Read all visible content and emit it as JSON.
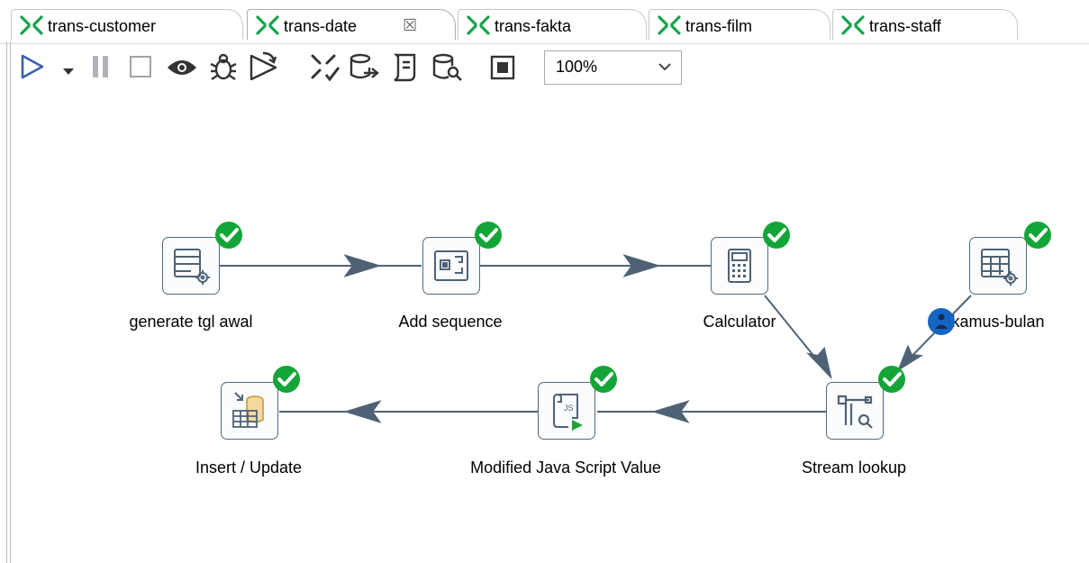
{
  "tabs": [
    {
      "label": "trans-customer",
      "active": false
    },
    {
      "label": "trans-date",
      "active": true,
      "close_glyph": "☒"
    },
    {
      "label": "trans-fakta",
      "active": false
    },
    {
      "label": "trans-film",
      "active": false
    },
    {
      "label": "trans-staff",
      "active": false
    }
  ],
  "toolbar": {
    "buttons": [
      "run-icon",
      "run-options-dropdown-icon",
      "pause-icon",
      "stop-icon",
      "preview-icon",
      "debug-icon",
      "replay-icon",
      "verify-icon",
      "impact-icon",
      "sql-icon",
      "explore-db-icon",
      "show-results-icon"
    ],
    "zoom": {
      "value": "100%"
    }
  },
  "steps": {
    "generate": {
      "label": "generate tgl awal"
    },
    "sequence": {
      "label": "Add sequence"
    },
    "calculator": {
      "label": "Calculator"
    },
    "kamus": {
      "label": "kamus-bulan"
    },
    "stream": {
      "label": "Stream lookup"
    },
    "script": {
      "label": "Modified Java Script Value"
    },
    "insert": {
      "label": "Insert / Update"
    }
  },
  "colors": {
    "check": "#13a538",
    "hop": "#4f6275",
    "info_badge": "#1565c0",
    "step_border": "#526a80"
  }
}
